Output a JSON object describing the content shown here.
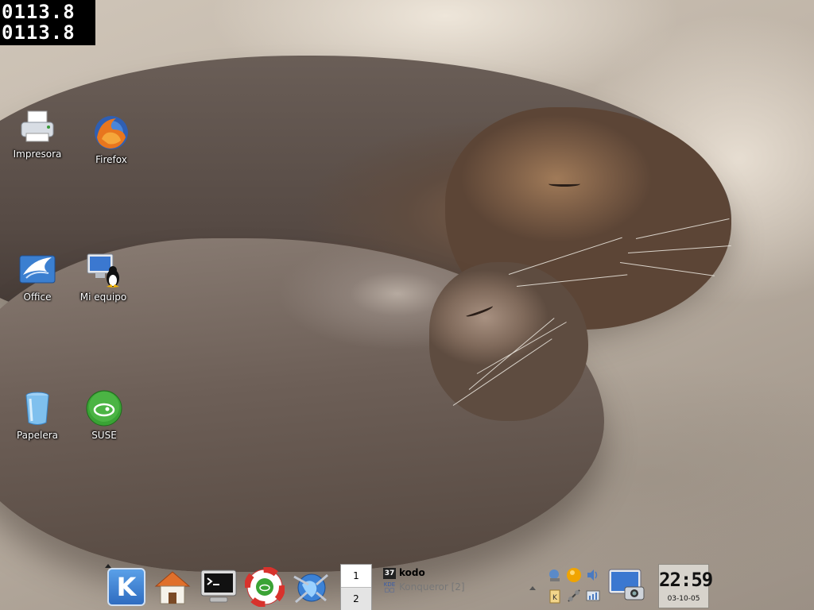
{
  "counter": {
    "line1": "0113.8",
    "line2": "0113.8"
  },
  "desktop_icons": [
    {
      "label": "Impresora",
      "icon": "printer-icon"
    },
    {
      "label": "Firefox",
      "icon": "firefox-icon"
    },
    {
      "label": "Office",
      "icon": "office-icon"
    },
    {
      "label": "Mi equipo",
      "icon": "computer-icon"
    },
    {
      "label": "Papelera",
      "icon": "trash-icon"
    },
    {
      "label": "SUSE",
      "icon": "suse-icon"
    }
  ],
  "panel": {
    "kmenu_label": "K",
    "quick_launch": [
      "home-icon",
      "terminal-icon",
      "help-icon",
      "konqueror-icon"
    ],
    "pager": [
      "1",
      "2"
    ],
    "tasks": [
      {
        "label": "kodo",
        "icon": "kodo-icon",
        "active": true
      },
      {
        "label": "Konqueror [2]",
        "icon": "kde-konqueror-icon",
        "active": false
      }
    ],
    "tray": [
      "network-icon",
      "status-orb-icon",
      "volume-icon",
      "klipper-icon",
      "connection-icon",
      "monitor-icon"
    ],
    "clock": {
      "time": "22:59",
      "date": "03-10-05"
    }
  },
  "colors": {
    "text_light": "#ffffff",
    "kmenu_blue": "#2f6cc0",
    "suse_green": "#3aa335",
    "clock_bg": "#d7d3cc"
  }
}
